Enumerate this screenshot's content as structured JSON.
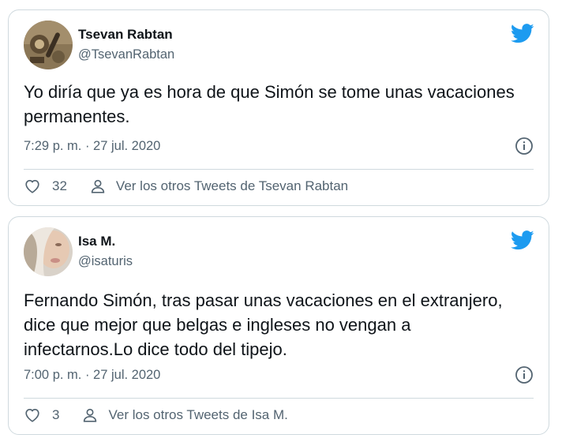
{
  "colors": {
    "twitter_blue": "#1d9bf0",
    "secondary_text": "#536471",
    "border": "#cfd9de"
  },
  "icons": {
    "bird": "twitter-bird-icon",
    "info": "info-icon",
    "like": "heart-icon",
    "person": "person-icon"
  },
  "tweets": [
    {
      "name": "Tsevan Rabtan",
      "handle": "@TsevanRabtan",
      "text": "Yo diría que ya es hora de que Simón se tome unas vacaciones permanentes.",
      "timestamp": "7:29 p. m. · 27 jul. 2020",
      "likes": "32",
      "more_tweets_label": "Ver los otros Tweets de Tsevan Rabtan"
    },
    {
      "name": "Isa M.",
      "handle": "@isaturis",
      "text": "Fernando Simón, tras pasar unas vacaciones en el extranjero, dice que mejor que belgas e ingleses no vengan a infectarnos.Lo dice todo del tipejo.",
      "timestamp": "7:00 p. m. · 27 jul. 2020",
      "likes": "3",
      "more_tweets_label": "Ver los otros Tweets de Isa M."
    }
  ]
}
